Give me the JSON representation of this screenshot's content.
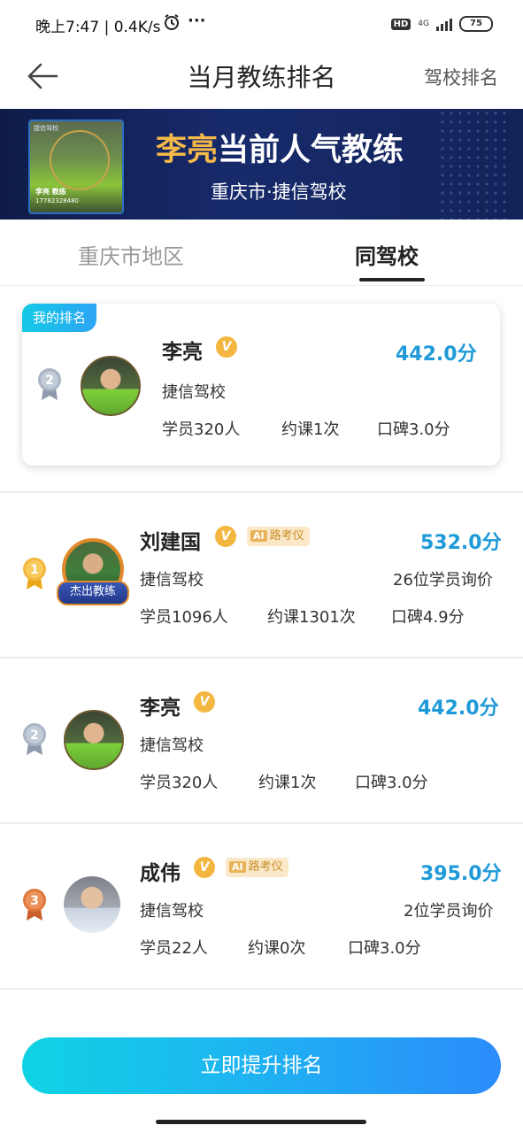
{
  "status_bar": {
    "time": "晚上7:47 | 0.4K/s",
    "alarm_icon": "alarm-icon",
    "more": "···",
    "hd": "HD",
    "network": "4G",
    "battery": "75"
  },
  "nav": {
    "title": "当月教练排名",
    "right_link": "驾校排名"
  },
  "banner": {
    "highlight_name": "李亮",
    "headline_rest": "当前人气教练",
    "subtitle": "重庆市·捷信驾校",
    "photo_tag": "捷信驾校",
    "photo_name": "李亮 教练",
    "photo_phone": "17782328480"
  },
  "tabs": [
    {
      "label": "重庆市地区",
      "active": false
    },
    {
      "label": "同驾校",
      "active": true
    }
  ],
  "my_rank": {
    "badge": "我的排名",
    "rank": "2",
    "name": "李亮",
    "verified": "V",
    "score": "442.0分",
    "school": "捷信驾校",
    "students": "学员320人",
    "lessons": "约课1次",
    "rating": "口碑3.0分"
  },
  "rankings": [
    {
      "rank": "1",
      "name": "刘建国",
      "verified": "V",
      "ai_tag": "AI",
      "tag_text": "路考仪",
      "frame_label": "杰出教练",
      "score": "532.0分",
      "school": "捷信驾校",
      "inquiries": "26位学员询价",
      "students": "学员1096人",
      "lessons": "约课1301次",
      "rating": "口碑4.9分"
    },
    {
      "rank": "2",
      "name": "李亮",
      "verified": "V",
      "score": "442.0分",
      "school": "捷信驾校",
      "students": "学员320人",
      "lessons": "约课1次",
      "rating": "口碑3.0分"
    },
    {
      "rank": "3",
      "name": "成伟",
      "verified": "V",
      "ai_tag": "AI",
      "tag_text": "路考仪",
      "score": "395.0分",
      "school": "捷信驾校",
      "inquiries": "2位学员询价",
      "students": "学员22人",
      "lessons": "约课0次",
      "rating": "口碑3.0分"
    }
  ],
  "cta": {
    "label": "立即提升排名"
  },
  "colors": {
    "score_blue": "#1f9ad8",
    "cta_start": "#10d3e4",
    "cta_end": "#2b8cfb",
    "gold": "#f3b640",
    "silver": "#a9b4c4",
    "bronze": "#e0773a"
  }
}
